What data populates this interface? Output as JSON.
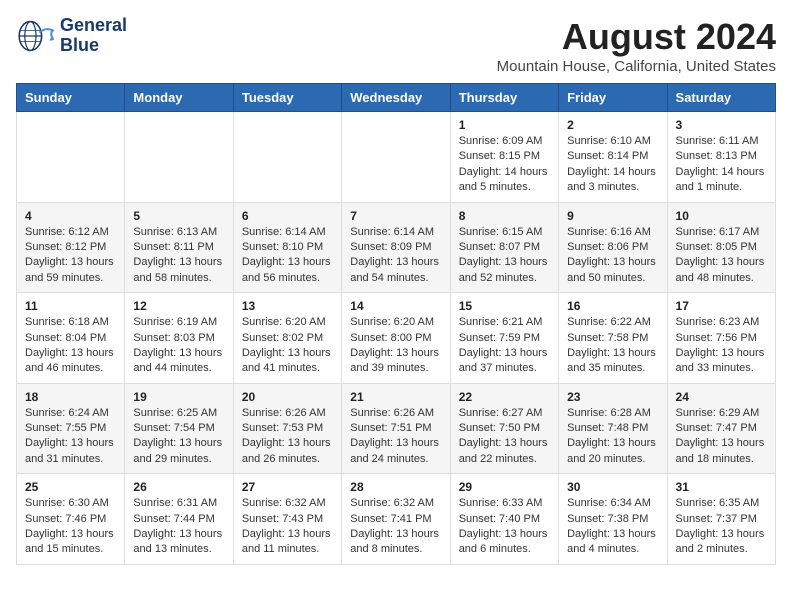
{
  "logo": {
    "line1": "General",
    "line2": "Blue"
  },
  "title": "August 2024",
  "subtitle": "Mountain House, California, United States",
  "days_of_week": [
    "Sunday",
    "Monday",
    "Tuesday",
    "Wednesday",
    "Thursday",
    "Friday",
    "Saturday"
  ],
  "weeks": [
    [
      {
        "day": "",
        "info": ""
      },
      {
        "day": "",
        "info": ""
      },
      {
        "day": "",
        "info": ""
      },
      {
        "day": "",
        "info": ""
      },
      {
        "day": "1",
        "info": "Sunrise: 6:09 AM\nSunset: 8:15 PM\nDaylight: 14 hours\nand 5 minutes."
      },
      {
        "day": "2",
        "info": "Sunrise: 6:10 AM\nSunset: 8:14 PM\nDaylight: 14 hours\nand 3 minutes."
      },
      {
        "day": "3",
        "info": "Sunrise: 6:11 AM\nSunset: 8:13 PM\nDaylight: 14 hours\nand 1 minute."
      }
    ],
    [
      {
        "day": "4",
        "info": "Sunrise: 6:12 AM\nSunset: 8:12 PM\nDaylight: 13 hours\nand 59 minutes."
      },
      {
        "day": "5",
        "info": "Sunrise: 6:13 AM\nSunset: 8:11 PM\nDaylight: 13 hours\nand 58 minutes."
      },
      {
        "day": "6",
        "info": "Sunrise: 6:14 AM\nSunset: 8:10 PM\nDaylight: 13 hours\nand 56 minutes."
      },
      {
        "day": "7",
        "info": "Sunrise: 6:14 AM\nSunset: 8:09 PM\nDaylight: 13 hours\nand 54 minutes."
      },
      {
        "day": "8",
        "info": "Sunrise: 6:15 AM\nSunset: 8:07 PM\nDaylight: 13 hours\nand 52 minutes."
      },
      {
        "day": "9",
        "info": "Sunrise: 6:16 AM\nSunset: 8:06 PM\nDaylight: 13 hours\nand 50 minutes."
      },
      {
        "day": "10",
        "info": "Sunrise: 6:17 AM\nSunset: 8:05 PM\nDaylight: 13 hours\nand 48 minutes."
      }
    ],
    [
      {
        "day": "11",
        "info": "Sunrise: 6:18 AM\nSunset: 8:04 PM\nDaylight: 13 hours\nand 46 minutes."
      },
      {
        "day": "12",
        "info": "Sunrise: 6:19 AM\nSunset: 8:03 PM\nDaylight: 13 hours\nand 44 minutes."
      },
      {
        "day": "13",
        "info": "Sunrise: 6:20 AM\nSunset: 8:02 PM\nDaylight: 13 hours\nand 41 minutes."
      },
      {
        "day": "14",
        "info": "Sunrise: 6:20 AM\nSunset: 8:00 PM\nDaylight: 13 hours\nand 39 minutes."
      },
      {
        "day": "15",
        "info": "Sunrise: 6:21 AM\nSunset: 7:59 PM\nDaylight: 13 hours\nand 37 minutes."
      },
      {
        "day": "16",
        "info": "Sunrise: 6:22 AM\nSunset: 7:58 PM\nDaylight: 13 hours\nand 35 minutes."
      },
      {
        "day": "17",
        "info": "Sunrise: 6:23 AM\nSunset: 7:56 PM\nDaylight: 13 hours\nand 33 minutes."
      }
    ],
    [
      {
        "day": "18",
        "info": "Sunrise: 6:24 AM\nSunset: 7:55 PM\nDaylight: 13 hours\nand 31 minutes."
      },
      {
        "day": "19",
        "info": "Sunrise: 6:25 AM\nSunset: 7:54 PM\nDaylight: 13 hours\nand 29 minutes."
      },
      {
        "day": "20",
        "info": "Sunrise: 6:26 AM\nSunset: 7:53 PM\nDaylight: 13 hours\nand 26 minutes."
      },
      {
        "day": "21",
        "info": "Sunrise: 6:26 AM\nSunset: 7:51 PM\nDaylight: 13 hours\nand 24 minutes."
      },
      {
        "day": "22",
        "info": "Sunrise: 6:27 AM\nSunset: 7:50 PM\nDaylight: 13 hours\nand 22 minutes."
      },
      {
        "day": "23",
        "info": "Sunrise: 6:28 AM\nSunset: 7:48 PM\nDaylight: 13 hours\nand 20 minutes."
      },
      {
        "day": "24",
        "info": "Sunrise: 6:29 AM\nSunset: 7:47 PM\nDaylight: 13 hours\nand 18 minutes."
      }
    ],
    [
      {
        "day": "25",
        "info": "Sunrise: 6:30 AM\nSunset: 7:46 PM\nDaylight: 13 hours\nand 15 minutes."
      },
      {
        "day": "26",
        "info": "Sunrise: 6:31 AM\nSunset: 7:44 PM\nDaylight: 13 hours\nand 13 minutes."
      },
      {
        "day": "27",
        "info": "Sunrise: 6:32 AM\nSunset: 7:43 PM\nDaylight: 13 hours\nand 11 minutes."
      },
      {
        "day": "28",
        "info": "Sunrise: 6:32 AM\nSunset: 7:41 PM\nDaylight: 13 hours\nand 8 minutes."
      },
      {
        "day": "29",
        "info": "Sunrise: 6:33 AM\nSunset: 7:40 PM\nDaylight: 13 hours\nand 6 minutes."
      },
      {
        "day": "30",
        "info": "Sunrise: 6:34 AM\nSunset: 7:38 PM\nDaylight: 13 hours\nand 4 minutes."
      },
      {
        "day": "31",
        "info": "Sunrise: 6:35 AM\nSunset: 7:37 PM\nDaylight: 13 hours\nand 2 minutes."
      }
    ]
  ]
}
